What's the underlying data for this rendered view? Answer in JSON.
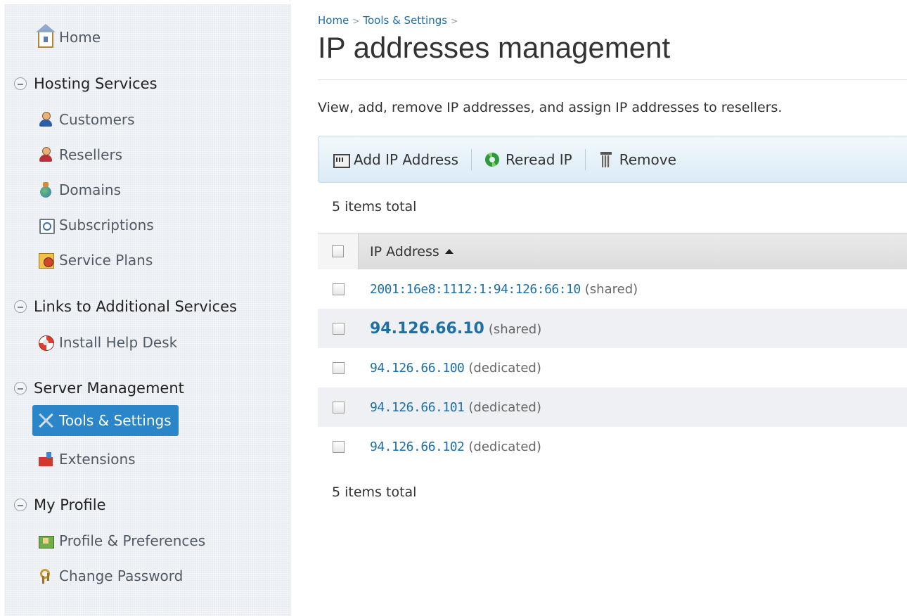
{
  "sidebar": {
    "home": "Home",
    "groups": [
      {
        "title": "Hosting Services",
        "items": [
          "Customers",
          "Resellers",
          "Domains",
          "Subscriptions",
          "Service Plans"
        ]
      },
      {
        "title": "Links to Additional Services",
        "items": [
          "Install Help Desk"
        ]
      },
      {
        "title": "Server Management",
        "items": [
          "Tools & Settings",
          "Extensions"
        ]
      },
      {
        "title": "My Profile",
        "items": [
          "Profile & Preferences",
          "Change Password"
        ]
      }
    ],
    "active_item": "Tools & Settings"
  },
  "breadcrumb": [
    "Home",
    "Tools & Settings"
  ],
  "page": {
    "title": "IP addresses management",
    "description": "View, add, remove IP addresses, and assign IP addresses to resellers."
  },
  "toolbar": {
    "add_label": "Add IP Address",
    "reread_label": "Reread IP",
    "remove_label": "Remove"
  },
  "items_total": "5 items total",
  "table": {
    "column_header": "IP Address",
    "rows": [
      {
        "ip": "2001:16e8:1112:1:94:126:66:10",
        "type": "(shared)"
      },
      {
        "ip": "94.126.66.10",
        "type": "(shared)"
      },
      {
        "ip": "94.126.66.100",
        "type": "(dedicated)"
      },
      {
        "ip": "94.126.66.101",
        "type": "(dedicated)"
      },
      {
        "ip": "94.126.66.102",
        "type": "(dedicated)"
      }
    ]
  },
  "colors": {
    "accent": "#2a86c9",
    "link": "#1d6fa5",
    "sidebar_bg": "#e9edf2"
  }
}
